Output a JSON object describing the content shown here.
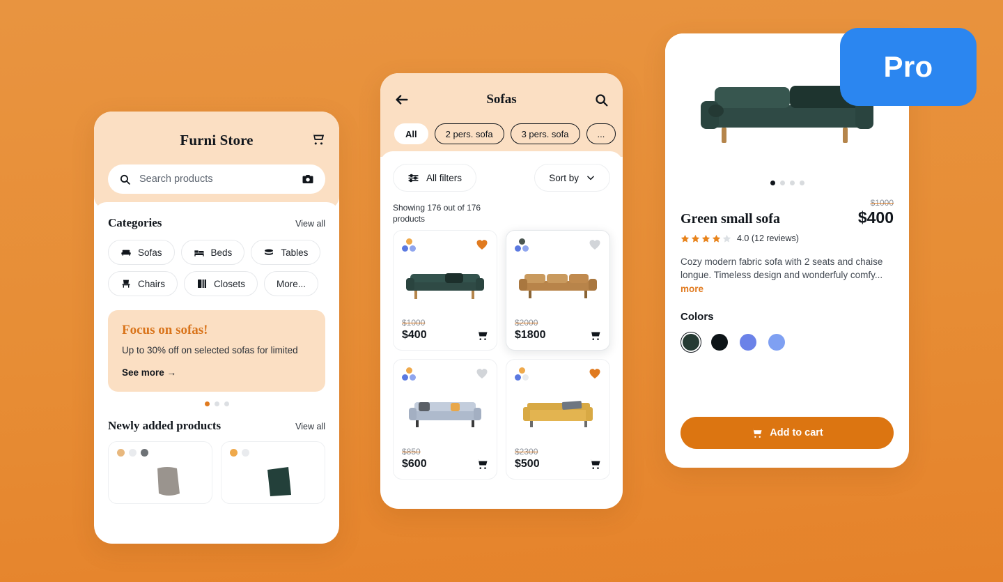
{
  "pro_badge": {
    "label": "Pro",
    "color": "#2B86F0"
  },
  "theme": {
    "background": "#E78D35",
    "accent": "#E07A1F",
    "cream": "#FBDFC3",
    "button": "#DC7511"
  },
  "home_screen": {
    "title": "Furni Store",
    "cart_icon": "shopping-cart-icon",
    "search": {
      "placeholder": "Search products",
      "search_icon": "search-icon",
      "camera_icon": "camera-icon"
    },
    "categories": {
      "title": "Categories",
      "view_all": "View all",
      "items": [
        {
          "label": "Sofas",
          "icon": "sofa-icon"
        },
        {
          "label": "Beds",
          "icon": "bed-icon"
        },
        {
          "label": "Tables",
          "icon": "table-icon"
        },
        {
          "label": "Chairs",
          "icon": "chair-icon"
        },
        {
          "label": "Closets",
          "icon": "closet-icon"
        },
        {
          "label": "More...",
          "icon": "none"
        }
      ]
    },
    "promo": {
      "title": "Focus on sofas!",
      "subtitle": "Up to 30% off on selected sofas for limited",
      "link": "See more →",
      "carousel_dots": 3,
      "carousel_active": 0
    },
    "newly_added": {
      "title": "Newly added products",
      "view_all": "View all",
      "cards": [
        {
          "dots": [
            "#E8B87E",
            "#E9EBEE",
            "#6E7276"
          ]
        },
        {
          "dots": [
            "#EFA94B",
            "#E9EBEE"
          ]
        }
      ]
    }
  },
  "list_screen": {
    "title": "Sofas",
    "back_icon": "arrow-left-icon",
    "search_icon": "search-icon",
    "filter_chips": [
      {
        "label": "All",
        "selected": true
      },
      {
        "label": "2 pers. sofa",
        "selected": false
      },
      {
        "label": "3 pers. sofa",
        "selected": false
      },
      {
        "label": "...",
        "selected": false
      }
    ],
    "all_filters_label": "All filters",
    "all_filters_icon": "sliders-icon",
    "sort_label": "Sort by",
    "sort_icon": "chevron-down-icon",
    "showing_text": "Showing 176 out of 176 products",
    "products": [
      {
        "old_price": "$1000",
        "price": "$400",
        "favorite": true,
        "sofa_color": "#2F4A45",
        "leg_color": "#B5854B",
        "dots": [
          "#EFA94B",
          "#5B79E0",
          "#8FA5EE"
        ]
      },
      {
        "old_price": "$2000",
        "price": "$1800",
        "favorite": false,
        "sofa_color": "#C08A4E",
        "leg_color": "#8A6434",
        "dots": [
          "#4A5550",
          "#5B79E0",
          "#8FA5EE"
        ]
      },
      {
        "old_price": "$850",
        "price": "$600",
        "favorite": false,
        "sofa_color": "#B9C4D6",
        "leg_color": "#3A3A3A",
        "dots": [
          "#EFA94B",
          "#5B79E0",
          "#8FA5EE"
        ]
      },
      {
        "old_price": "$2300",
        "price": "$500",
        "favorite": true,
        "sofa_color": "#E3B450",
        "leg_color": "#6B6B6B",
        "dots": [
          "#EFA94B",
          "#5B79E0",
          "#E9EBEE"
        ]
      }
    ]
  },
  "detail_screen": {
    "name": "Green small sofa",
    "old_price": "$1000",
    "price": "$400",
    "rating_value": "4.0",
    "rating_text": "4.0 (12 reviews)",
    "stars_filled": 4,
    "stars_total": 5,
    "description": "Cozy modern fabric sofa with 2 seats and chaise longue. Timeless design and wonderfuly comfy...",
    "more_label": "more",
    "colors_label": "Colors",
    "colors": [
      {
        "hex": "#253A33",
        "selected": true
      },
      {
        "hex": "#0D1417",
        "selected": false
      },
      {
        "hex": "#6B82E8",
        "selected": false
      },
      {
        "hex": "#7FA0F2",
        "selected": false
      }
    ],
    "gallery_dots": 4,
    "gallery_active": 0,
    "add_to_cart_label": "Add to cart",
    "add_to_cart_icon": "shopping-cart-icon"
  }
}
